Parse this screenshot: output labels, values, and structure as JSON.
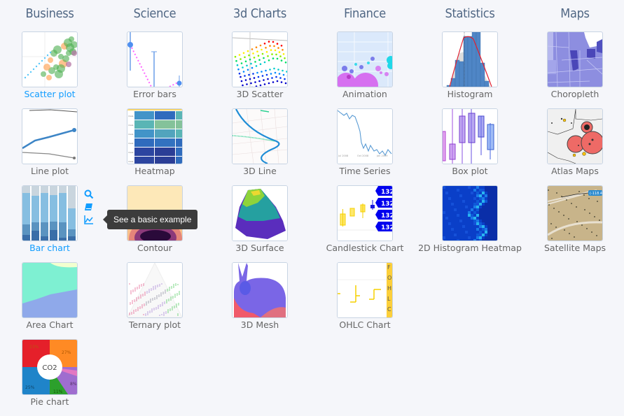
{
  "accent_color": "#119dff",
  "heading_color": "#506784",
  "columns": [
    {
      "title": "Business",
      "items": [
        {
          "label": "Scatter plot",
          "active": true,
          "thumb": "scatter"
        },
        {
          "label": "Line plot",
          "thumb": "line"
        },
        {
          "label": "Bar chart",
          "active": true,
          "thumb": "bar"
        },
        {
          "label": "Area Chart",
          "thumb": "area"
        },
        {
          "label": "Pie chart",
          "thumb": "pie"
        }
      ]
    },
    {
      "title": "Science",
      "items": [
        {
          "label": "Error bars",
          "thumb": "errorbars"
        },
        {
          "label": "Heatmap",
          "thumb": "heatmap"
        },
        {
          "label": "Contour",
          "thumb": "contour"
        },
        {
          "label": "Ternary plot",
          "thumb": "ternary"
        }
      ]
    },
    {
      "title": "3d Charts",
      "items": [
        {
          "label": "3D Scatter",
          "thumb": "scatter3d"
        },
        {
          "label": "3D Line",
          "thumb": "line3d"
        },
        {
          "label": "3D Surface",
          "thumb": "surface"
        },
        {
          "label": "3D Mesh",
          "thumb": "mesh"
        }
      ]
    },
    {
      "title": "Finance",
      "items": [
        {
          "label": "Animation",
          "thumb": "animation"
        },
        {
          "label": "Time Series",
          "thumb": "timeseries"
        },
        {
          "label": "Candlestick Chart",
          "thumb": "candlestick"
        },
        {
          "label": "OHLC Chart",
          "thumb": "ohlc"
        }
      ]
    },
    {
      "title": "Statistics",
      "items": [
        {
          "label": "Histogram",
          "thumb": "histogram"
        },
        {
          "label": "Box plot",
          "thumb": "box"
        },
        {
          "label": "2D Histogram Heatmap",
          "thumb": "hist2d"
        }
      ]
    },
    {
      "title": "Maps",
      "items": [
        {
          "label": "Choropleth",
          "thumb": "choropleth"
        },
        {
          "label": "Atlas Maps",
          "thumb": "atlas"
        },
        {
          "label": "Satellite Maps",
          "thumb": "satellite"
        }
      ]
    }
  ],
  "hover_actions": {
    "icons": [
      "search-icon",
      "book-icon",
      "chart-line-icon"
    ],
    "tooltip": "See a basic example"
  },
  "thumb_text": {
    "pie_center": "CO2",
    "pie_labels": [
      "23%",
      "27%",
      "25%",
      "11%",
      "8%"
    ],
    "candlestick_labels": [
      "132",
      "132",
      "132",
      "132"
    ],
    "ohlc_labels": [
      "F",
      "O",
      "H",
      "L",
      "C"
    ],
    "satellite_tag": "(-118.4",
    "timeseries_ticks": [
      "Jul 2008",
      "Oct 2008",
      "Jan 2009"
    ],
    "heatmap_rows": [
      "male",
      "male",
      "male",
      "male",
      "male",
      "male"
    ]
  }
}
